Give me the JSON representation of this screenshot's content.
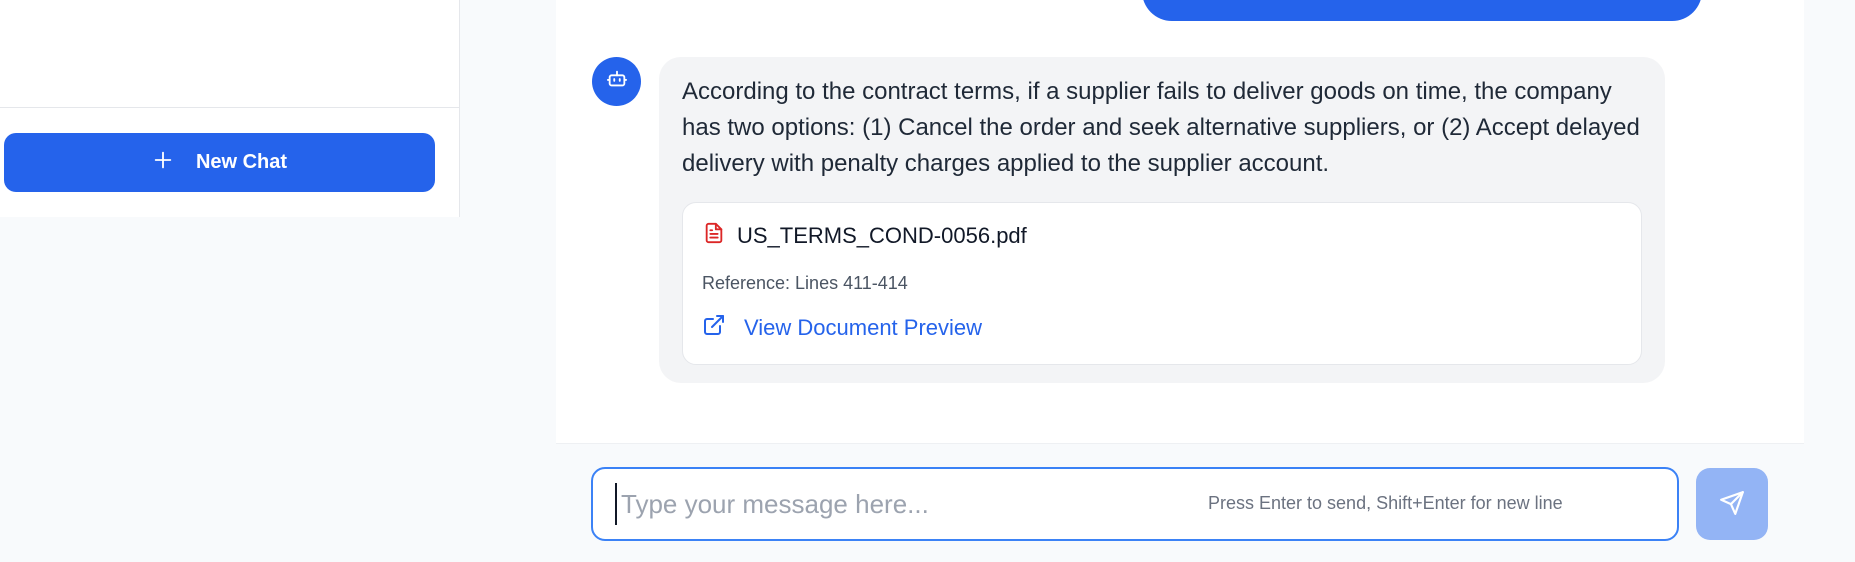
{
  "sidebar": {
    "new_chat_label": "New Chat",
    "new_chat_icon": "plus-icon"
  },
  "conversation": {
    "bot_avatar_icon": "robot-icon",
    "bot_message": "According to the contract terms, if a supplier fails to deliver goods on time, the company has two options: (1) Cancel the order and seek alternative suppliers, or (2) Accept delayed delivery with penalty charges applied to the supplier account.",
    "source": {
      "file_icon": "pdf-file-icon",
      "file_name": "US_TERMS_COND-0056.pdf",
      "reference": "Reference: Lines 411-414",
      "preview_icon": "external-link-icon",
      "preview_label": "View Document Preview"
    }
  },
  "composer": {
    "value": "",
    "placeholder": "Type your message here...",
    "hint": "Press Enter to send, Shift+Enter for new line",
    "send_icon": "send-icon"
  },
  "colors": {
    "accent": "#2563eb",
    "send_disabled": "#93b4f5",
    "pdf_icon": "#dc2626",
    "bubble_bg": "#f3f4f6"
  }
}
